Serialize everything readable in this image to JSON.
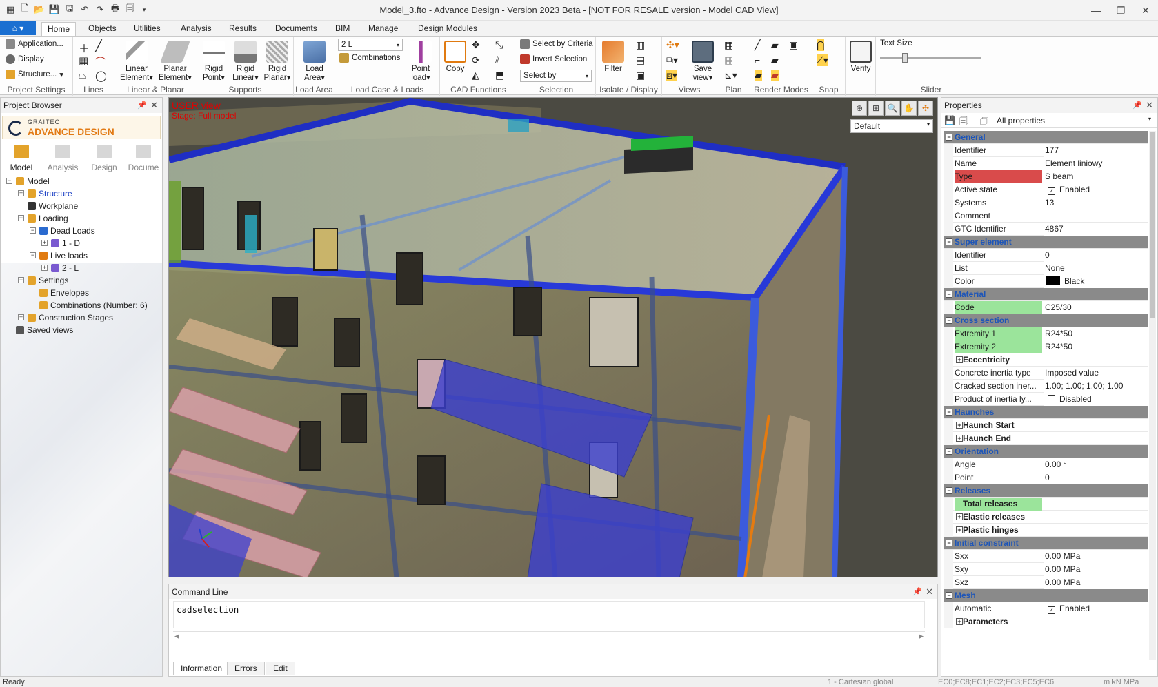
{
  "window": {
    "title": "Model_3.fto - Advance Design - Version 2023 Beta - [NOT FOR RESALE version - Model CAD View]"
  },
  "ribbon_tabs": [
    "Home",
    "Objects",
    "Utilities",
    "Analysis",
    "Results",
    "Documents",
    "BIM",
    "Manage",
    "Design Modules"
  ],
  "ribbon": {
    "project_settings": {
      "label": "Project Settings",
      "items": [
        "Application...",
        "Display",
        "Structure..."
      ]
    },
    "lines": {
      "label": "Lines"
    },
    "linear_planar": {
      "label": "Linear & Planar",
      "linear_element": "Linear\nElement",
      "planar_element": "Planar\nElement"
    },
    "supports": {
      "label": "Supports",
      "rigid_point": "Rigid\nPoint",
      "rigid_linear": "Rigid\nLinear",
      "rigid_planar": "Rigid\nPlanar"
    },
    "load_area": {
      "label": "Load Area",
      "button": "Load\nArea"
    },
    "load_case": {
      "label": "Load Case & Loads",
      "case_select": "2 L",
      "combinations": "Combinations",
      "point_load": "Point\nload"
    },
    "cad_functions": {
      "label": "CAD Functions",
      "copy": "Copy"
    },
    "selection": {
      "label": "Selection",
      "select_by_criteria": "Select by Criteria",
      "invert_selection": "Invert Selection",
      "select_by": "Select by"
    },
    "isolate_display": {
      "label": "Isolate / Display",
      "filter": "Filter"
    },
    "views": {
      "label": "Views",
      "save_view": "Save\nview"
    },
    "plan": {
      "label": "Plan"
    },
    "render_modes": {
      "label": "Render Modes"
    },
    "snap": {
      "label": "Snap"
    },
    "verify": {
      "label": "Verify"
    },
    "slider": {
      "label": "Slider",
      "text_size": "Text Size"
    }
  },
  "project_browser": {
    "title": "Project Browser",
    "logo_top": "GRAITEC",
    "logo_main": "ADVANCE DESIGN",
    "tabs": [
      "Model",
      "Analysis",
      "Design",
      "Docume"
    ],
    "tree": [
      {
        "label": "Model",
        "level": 0,
        "exp": "-"
      },
      {
        "label": "Structure",
        "level": 1,
        "exp": "+",
        "link": true
      },
      {
        "label": "Workplane",
        "level": 1,
        "exp": ""
      },
      {
        "label": "Loading",
        "level": 1,
        "exp": "-"
      },
      {
        "label": "Dead Loads",
        "level": 2,
        "exp": "-"
      },
      {
        "label": "1 - D",
        "level": 3,
        "exp": "+"
      },
      {
        "label": "Live loads",
        "level": 2,
        "exp": "-"
      },
      {
        "label": "2 - L",
        "level": 3,
        "exp": "+"
      },
      {
        "label": "Settings",
        "level": 1,
        "exp": "-"
      },
      {
        "label": "Envelopes",
        "level": 2,
        "exp": ""
      },
      {
        "label": "Combinations (Number: 6)",
        "level": 2,
        "exp": ""
      },
      {
        "label": "Construction Stages",
        "level": 1,
        "exp": "+"
      },
      {
        "label": "Saved views",
        "level": 0,
        "exp": ""
      }
    ]
  },
  "viewport": {
    "view_label": "USER view",
    "stage_label": "Stage: Full model",
    "view_preset": "Default"
  },
  "command_line": {
    "title": "Command Line",
    "text": "cadselection",
    "tabs": [
      "Information",
      "Errors",
      "Edit"
    ]
  },
  "properties": {
    "title": "Properties",
    "filter": "All properties",
    "rows": [
      {
        "kind": "cat",
        "name": "General"
      },
      {
        "name": "Identifier",
        "value": "177"
      },
      {
        "name": "Name",
        "value": "Element liniowy"
      },
      {
        "name": "Type",
        "value": "S beam",
        "hl": "red"
      },
      {
        "name": "Active state",
        "value": "Enabled",
        "check": true
      },
      {
        "name": "Systems",
        "value": "13"
      },
      {
        "name": "Comment",
        "value": ""
      },
      {
        "name": "GTC Identifier",
        "value": "4867"
      },
      {
        "kind": "cat",
        "name": "Super element"
      },
      {
        "name": "Identifier",
        "value": "0"
      },
      {
        "name": "List",
        "value": "None"
      },
      {
        "name": "Color",
        "value": "Black",
        "swatch": "#000000"
      },
      {
        "kind": "cat",
        "name": "Material"
      },
      {
        "name": "Code",
        "value": "C25/30",
        "hl": "green"
      },
      {
        "kind": "cat",
        "name": "Cross section"
      },
      {
        "name": "Extremity 1",
        "value": "R24*50",
        "hl": "green"
      },
      {
        "name": "Extremity 2",
        "value": "R24*50",
        "hl": "green"
      },
      {
        "kind": "sub",
        "name": "Eccentricity"
      },
      {
        "name": "Concrete inertia type",
        "value": "Imposed value"
      },
      {
        "name": "Cracked section iner...",
        "value": "1.00; 1.00; 1.00; 1.00"
      },
      {
        "name": "Product of inertia ly...",
        "value": "Disabled",
        "check": false
      },
      {
        "kind": "cat",
        "name": "Haunches"
      },
      {
        "kind": "sub",
        "name": "Haunch Start"
      },
      {
        "kind": "sub",
        "name": "Haunch End"
      },
      {
        "kind": "cat",
        "name": "Orientation"
      },
      {
        "name": "Angle",
        "value": "0.00 °"
      },
      {
        "name": "Point",
        "value": "0"
      },
      {
        "kind": "cat",
        "name": "Releases"
      },
      {
        "kind": "sub",
        "name": "Total releases",
        "hl": "green"
      },
      {
        "kind": "sub",
        "name": "Elastic releases"
      },
      {
        "kind": "sub",
        "name": "Plastic hinges"
      },
      {
        "kind": "cat",
        "name": "Initial constraint"
      },
      {
        "name": "Sxx",
        "value": "0.00 MPa"
      },
      {
        "name": "Sxy",
        "value": "0.00 MPa"
      },
      {
        "name": "Sxz",
        "value": "0.00 MPa"
      },
      {
        "kind": "cat",
        "name": "Mesh"
      },
      {
        "name": "Automatic",
        "value": "Enabled",
        "check": true
      },
      {
        "kind": "sub",
        "name": "Parameters"
      }
    ]
  },
  "status_bar": {
    "left": "Ready",
    "system": "1 - Cartesian global",
    "codes": "EC0;EC8;EC1;EC2;EC3;EC5;EC6",
    "units": "m kN MPa"
  }
}
